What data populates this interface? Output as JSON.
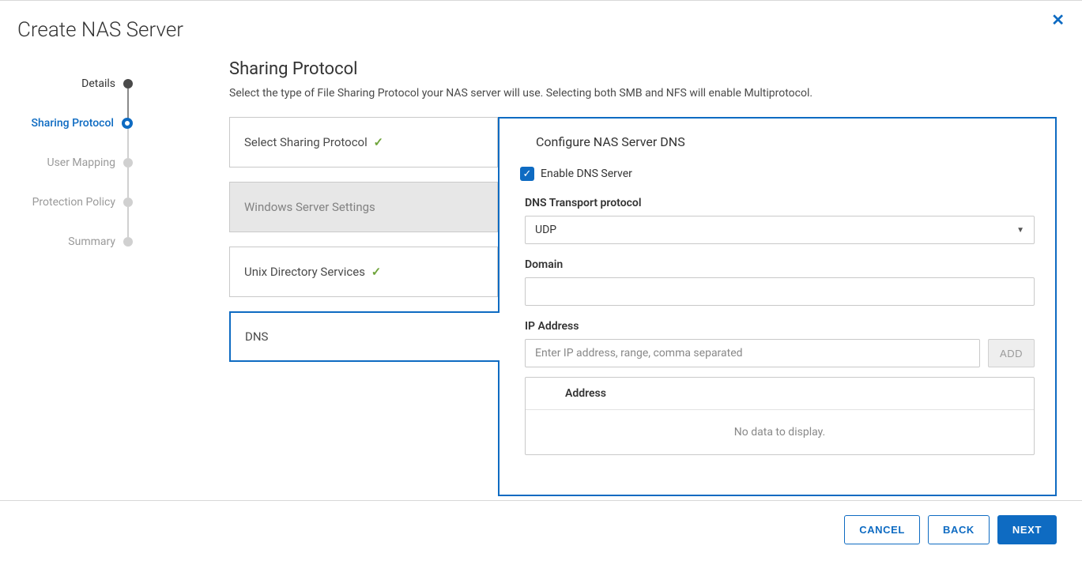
{
  "page_title": "Create NAS Server",
  "close_icon": "✕",
  "stepper": {
    "items": [
      {
        "label": "Details",
        "state": "done"
      },
      {
        "label": "Sharing Protocol",
        "state": "active"
      },
      {
        "label": "User Mapping",
        "state": "pending"
      },
      {
        "label": "Protection Policy",
        "state": "pending"
      },
      {
        "label": "Summary",
        "state": "pending"
      }
    ]
  },
  "section": {
    "title": "Sharing Protocol",
    "description": "Select the type of File Sharing Protocol your NAS server will use. Selecting both SMB and NFS will enable Multiprotocol."
  },
  "sub_steps": [
    {
      "label": "Select Sharing Protocol",
      "status": "complete",
      "style": "normal"
    },
    {
      "label": "Windows Server Settings",
      "status": "none",
      "style": "dim"
    },
    {
      "label": "Unix Directory Services",
      "status": "complete",
      "style": "normal"
    },
    {
      "label": "DNS",
      "status": "none",
      "style": "active"
    }
  ],
  "dns_panel": {
    "title": "Configure NAS Server DNS",
    "enable_label": "Enable DNS Server",
    "enable_checked": true,
    "transport_label": "DNS Transport protocol",
    "transport_value": "UDP",
    "domain_label": "Domain",
    "domain_value": "",
    "ip_label": "IP Address",
    "ip_placeholder": "Enter IP address, range, comma separated",
    "ip_value": "",
    "add_button": "ADD",
    "table_header": "Address",
    "empty_text": "No data to display."
  },
  "footer": {
    "cancel": "CANCEL",
    "back": "BACK",
    "next": "NEXT"
  }
}
